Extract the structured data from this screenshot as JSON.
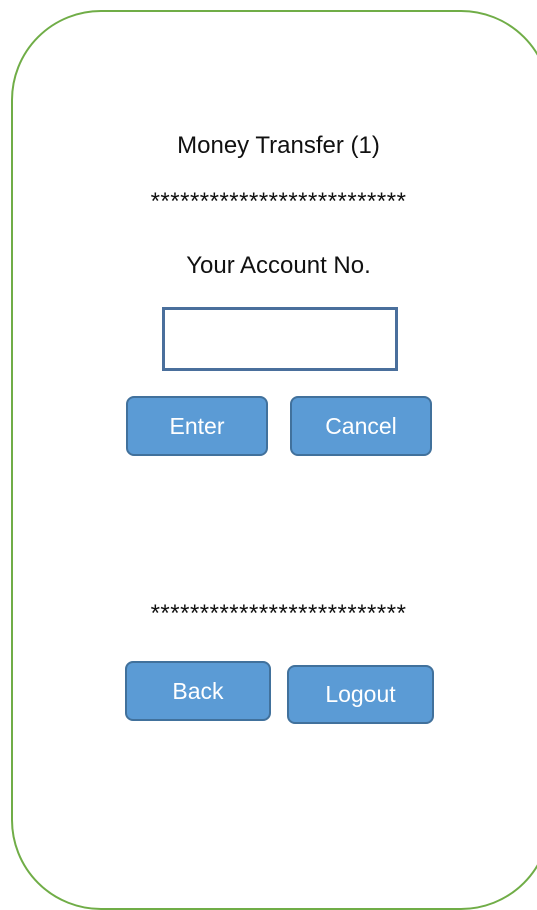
{
  "screen": {
    "title": "Money Transfer (1)",
    "separator_top": "**************************",
    "account_label": "Your Account No.",
    "account_input": {
      "value": "",
      "placeholder": ""
    },
    "separator_bottom": "**************************"
  },
  "buttons": {
    "enter": "Enter",
    "cancel": "Cancel",
    "back": "Back",
    "logout": "Logout"
  },
  "colors": {
    "frame_border": "#70ad47",
    "button_fill": "#5b9bd5",
    "button_border": "#41719c",
    "input_border": "#4a6f9c"
  }
}
